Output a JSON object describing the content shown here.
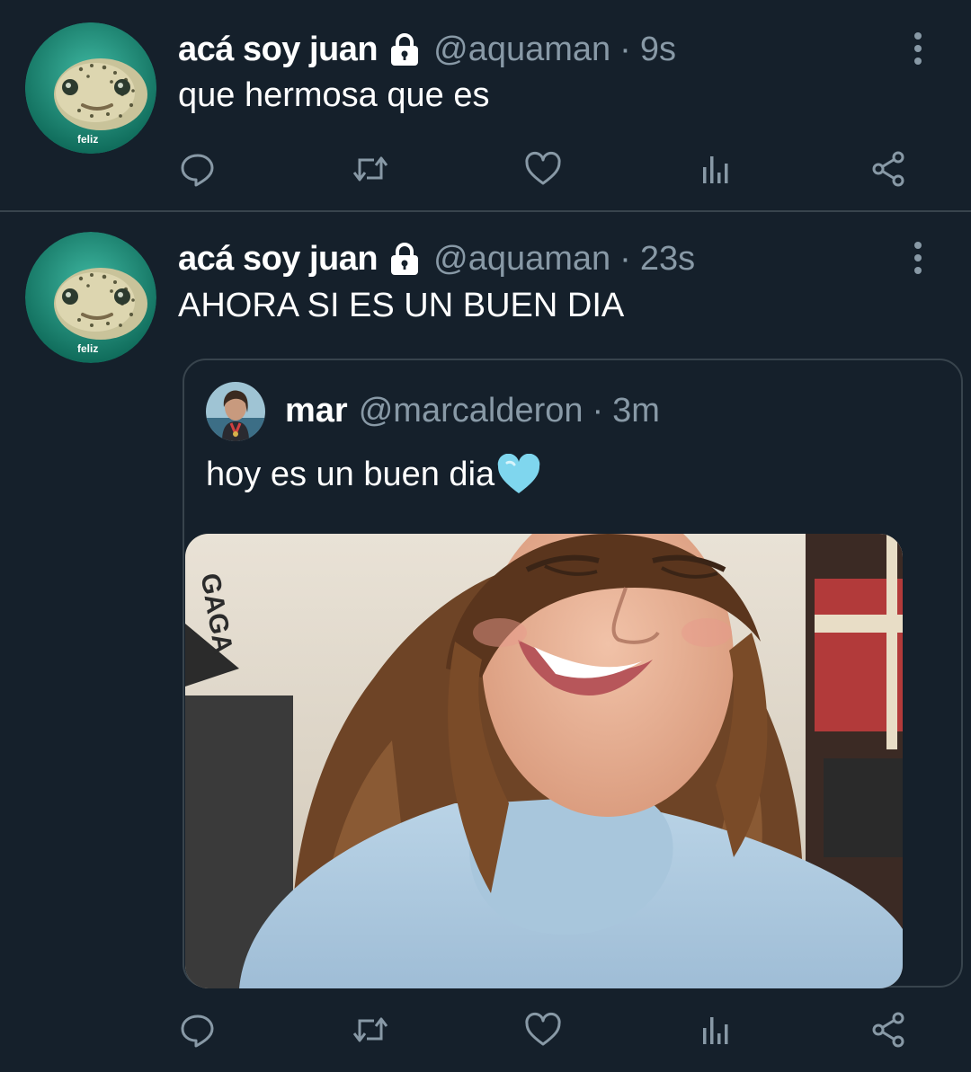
{
  "tweets": [
    {
      "display_name": "acá soy juan",
      "handle": "@aquaman",
      "separator": "·",
      "time": "9s",
      "text": "que hermosa que es",
      "avatar_caption": "feliz",
      "icons": {
        "protected": "lock-icon",
        "more": "more-vertical-icon"
      }
    },
    {
      "display_name": "acá soy juan",
      "handle": "@aquaman",
      "separator": "·",
      "time": "23s",
      "text": "AHORA SI ES UN BUEN DIA",
      "avatar_caption": "feliz",
      "icons": {
        "protected": "lock-icon",
        "more": "more-vertical-icon"
      },
      "quote": {
        "display_name": "mar",
        "handle": "@marcalderon",
        "separator": "·",
        "time": "3m",
        "text": "hoy es un buen dia",
        "emoji": "light-blue-heart-emoji",
        "media": "selfie-photo",
        "media_background_text": "GAGA"
      }
    }
  ],
  "actions": [
    "reply-icon",
    "retweet-icon",
    "like-icon",
    "analytics-icon",
    "share-icon"
  ],
  "colors": {
    "background": "#15202b",
    "border": "#38444d",
    "secondary_text": "#8899a6",
    "primary_text": "#ffffff",
    "heart_emoji": "#7fd6ee"
  }
}
